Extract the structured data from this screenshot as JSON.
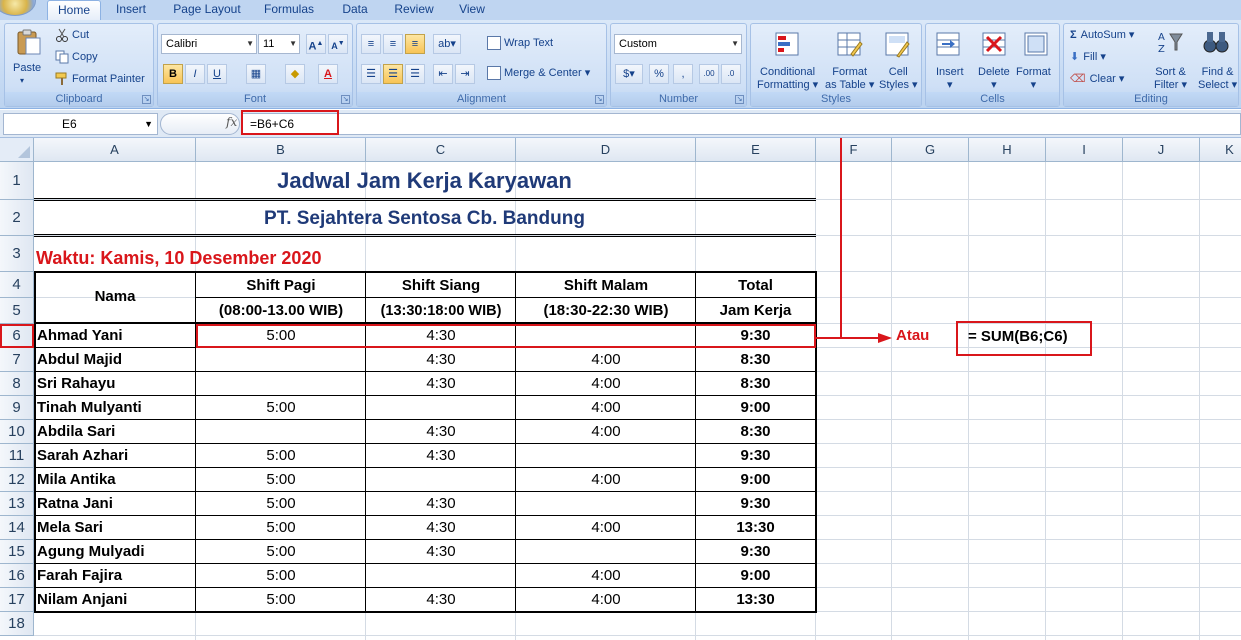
{
  "ribbon": {
    "tabs": [
      "Home",
      "Insert",
      "Page Layout",
      "Formulas",
      "Data",
      "Review",
      "View"
    ],
    "clipboard": {
      "paste": "Paste",
      "cut": "Cut",
      "copy": "Copy",
      "format_painter": "Format Painter",
      "label": "Clipboard"
    },
    "font": {
      "name": "Calibri",
      "size": "11",
      "label": "Font"
    },
    "alignment": {
      "wrap": "Wrap Text",
      "merge": "Merge & Center",
      "label": "Alignment"
    },
    "number": {
      "format": "Custom",
      "label": "Number"
    },
    "styles": {
      "conditional_1": "Conditional",
      "conditional_2": "Formatting",
      "table_1": "Format",
      "table_2": "as Table",
      "cell_1": "Cell",
      "cell_2": "Styles",
      "label": "Styles"
    },
    "cells": {
      "insert": "Insert",
      "delete": "Delete",
      "format": "Format",
      "label": "Cells"
    },
    "editing": {
      "autosum": "AutoSum",
      "fill": "Fill",
      "clear": "Clear",
      "sort_1": "Sort &",
      "sort_2": "Filter",
      "find_1": "Find &",
      "find_2": "Select",
      "label": "Editing"
    }
  },
  "formula_bar": {
    "name_box": "E6",
    "fx": "fx",
    "formula": "=B6+C6"
  },
  "columns": [
    "A",
    "B",
    "C",
    "D",
    "E",
    "F",
    "G",
    "H",
    "I",
    "J",
    "K"
  ],
  "rows": [
    "1",
    "2",
    "3",
    "4",
    "5",
    "6",
    "7",
    "8",
    "9",
    "10",
    "11",
    "12",
    "13",
    "14",
    "15",
    "16",
    "17",
    "18"
  ],
  "sheet": {
    "title": "Jadwal Jam Kerja Karyawan",
    "company": "PT. Sejahtera Sentosa Cb. Bandung",
    "waktu": "Waktu: Kamis, 10 Desember 2020",
    "headers": {
      "nama": "Nama",
      "pagi": "Shift Pagi",
      "pagi_time": "(08:00-13.00 WIB)",
      "siang": "Shift Siang",
      "siang_time": "(13:30:18:00 WIB)",
      "malam": "Shift Malam",
      "malam_time": "(18:30-22:30 WIB)",
      "total": "Total",
      "total_sub": "Jam Kerja"
    },
    "data": [
      {
        "nama": "Ahmad Yani",
        "pagi": "5:00",
        "siang": "4:30",
        "malam": "",
        "total": "9:30"
      },
      {
        "nama": "Abdul Majid",
        "pagi": "",
        "siang": "4:30",
        "malam": "4:00",
        "total": "8:30"
      },
      {
        "nama": "Sri Rahayu",
        "pagi": "",
        "siang": "4:30",
        "malam": "4:00",
        "total": "8:30"
      },
      {
        "nama": "Tinah Mulyanti",
        "pagi": "5:00",
        "siang": "",
        "malam": "4:00",
        "total": "9:00"
      },
      {
        "nama": "Abdila Sari",
        "pagi": "",
        "siang": "4:30",
        "malam": "4:00",
        "total": "8:30"
      },
      {
        "nama": "Sarah Azhari",
        "pagi": "5:00",
        "siang": "4:30",
        "malam": "",
        "total": "9:30"
      },
      {
        "nama": "Mila Antika",
        "pagi": "5:00",
        "siang": "",
        "malam": "4:00",
        "total": "9:00"
      },
      {
        "nama": "Ratna Jani",
        "pagi": "5:00",
        "siang": "4:30",
        "malam": "",
        "total": "9:30"
      },
      {
        "nama": "Mela Sari",
        "pagi": "5:00",
        "siang": "4:30",
        "malam": "4:00",
        "total": "13:30"
      },
      {
        "nama": "Agung Mulyadi",
        "pagi": "5:00",
        "siang": "4:30",
        "malam": "",
        "total": "9:30"
      },
      {
        "nama": "Farah Fajira",
        "pagi": "5:00",
        "siang": "",
        "malam": "4:00",
        "total": "9:00"
      },
      {
        "nama": "Nilam Anjani",
        "pagi": "5:00",
        "siang": "4:30",
        "malam": "4:00",
        "total": "13:30"
      }
    ]
  },
  "annotation": {
    "atau": "Atau",
    "alt_formula": "= SUM(B6;C6)",
    "highlight_color": "#d9161b"
  }
}
